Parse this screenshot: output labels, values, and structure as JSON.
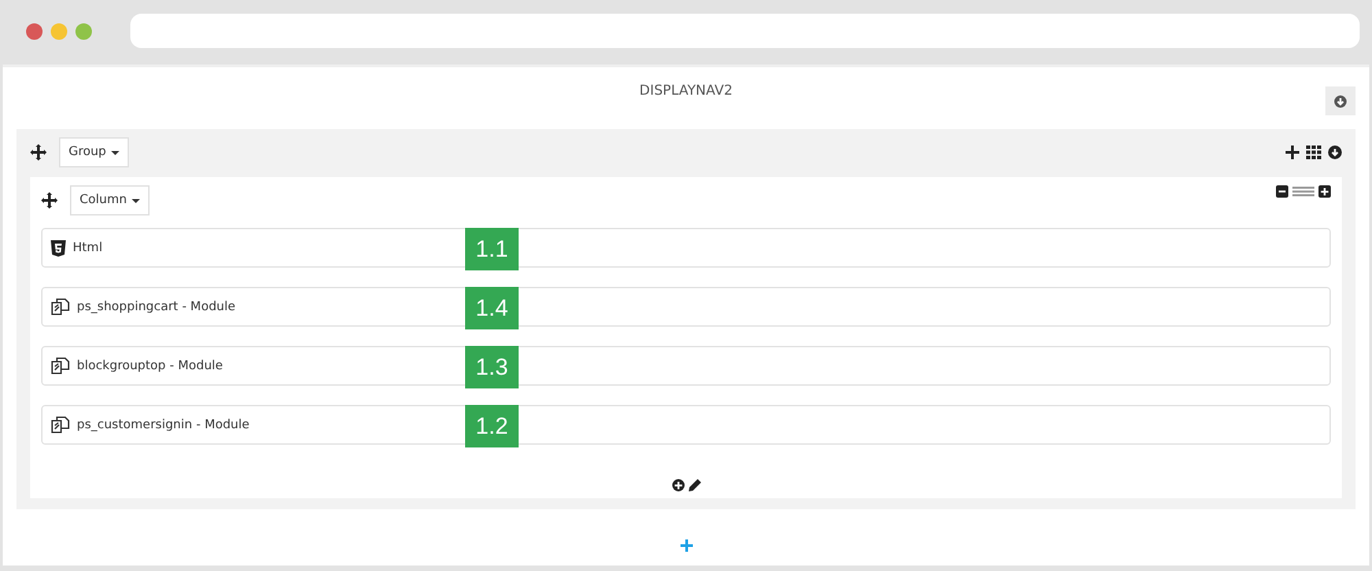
{
  "hook": {
    "title": "DISPLAYNAV2"
  },
  "group": {
    "label": "Group"
  },
  "column": {
    "label": "Column"
  },
  "items": [
    {
      "kind": "html",
      "label": "Html",
      "badge": "1.1"
    },
    {
      "kind": "module",
      "label": "ps_shoppingcart - Module",
      "badge": "1.4"
    },
    {
      "kind": "module",
      "label": "blockgrouptop - Module",
      "badge": "1.3"
    },
    {
      "kind": "module",
      "label": "ps_customersignin - Module",
      "badge": "1.2"
    }
  ]
}
